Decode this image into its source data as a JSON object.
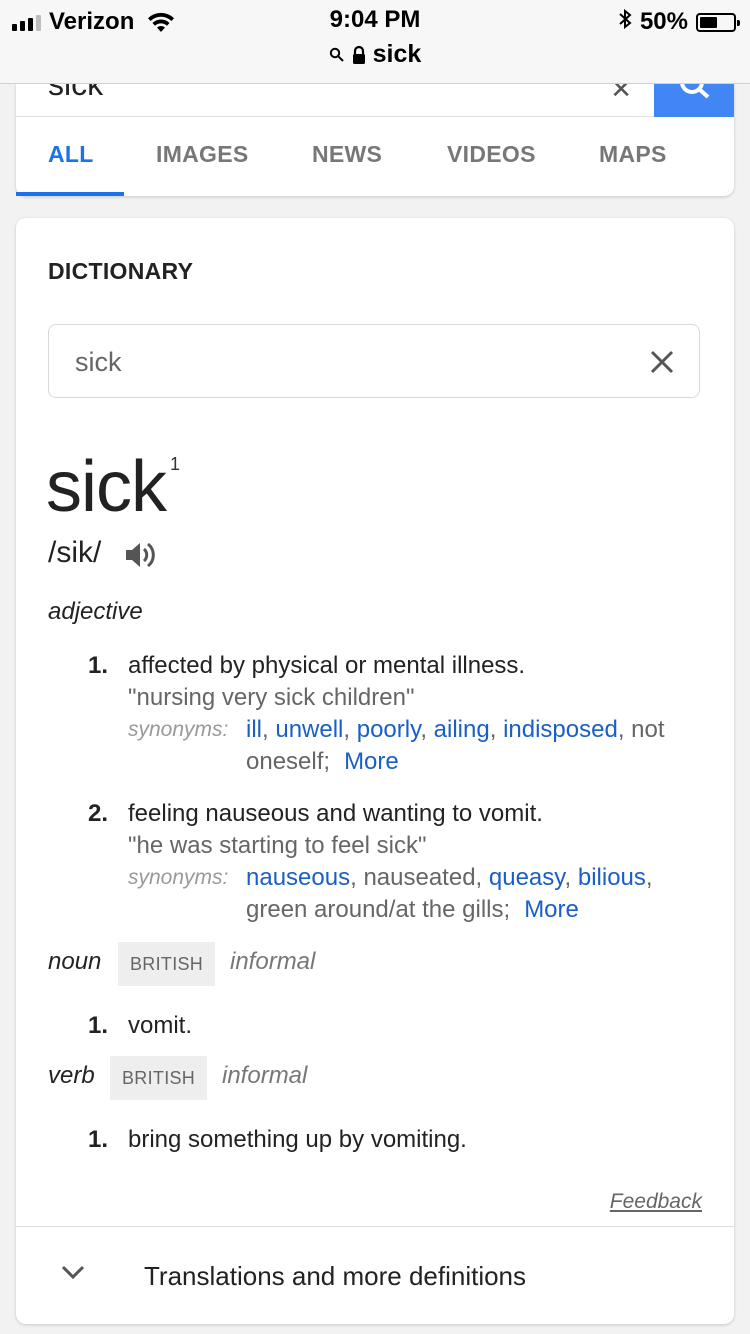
{
  "status_bar": {
    "carrier": "Verizon",
    "time": "9:04 PM",
    "battery_percent": "50%",
    "battery_level": 0.5
  },
  "url_bar": {
    "text": "sick"
  },
  "search": {
    "query": "sick"
  },
  "tabs": [
    {
      "label": "ALL",
      "active": true
    },
    {
      "label": "IMAGES",
      "active": false
    },
    {
      "label": "NEWS",
      "active": false
    },
    {
      "label": "VIDEOS",
      "active": false
    },
    {
      "label": "MAPS",
      "active": false
    }
  ],
  "dictionary": {
    "heading": "DICTIONARY",
    "search_value": "sick",
    "word": "sick",
    "superscript": "1",
    "phonetic": "/sik/",
    "entries": [
      {
        "pos": "adjective",
        "senses": [
          {
            "num": "1.",
            "definition": "affected by physical or mental illness.",
            "example": "\"nursing very sick children\"",
            "synonyms_label": "synonyms:",
            "synonyms_linked": [
              "ill",
              "unwell",
              "poorly",
              "ailing",
              "indisposed"
            ],
            "synonyms_plain": "not oneself;",
            "more": "More"
          },
          {
            "num": "2.",
            "definition": "feeling nauseous and wanting to vomit.",
            "example": "\"he was starting to feel sick\"",
            "synonyms_label": "synonyms:",
            "synonyms_linked": [
              "nauseous",
              "queasy",
              "bilious"
            ],
            "synonyms_plain_mid": "nauseated",
            "synonyms_plain": "green around/at the gills;",
            "more": "More"
          }
        ]
      },
      {
        "pos": "noun",
        "badge": "BRITISH",
        "register": "informal",
        "senses": [
          {
            "num": "1.",
            "definition": "vomit."
          }
        ]
      },
      {
        "pos": "verb",
        "badge": "BRITISH",
        "register": "informal",
        "senses": [
          {
            "num": "1.",
            "definition": "bring something up by vomiting."
          }
        ]
      }
    ],
    "feedback": "Feedback",
    "more_definitions": "Translations and more definitions"
  },
  "colors": {
    "accent": "#1a73e8",
    "link": "#1a5fc8",
    "search_button": "#4285f4"
  }
}
